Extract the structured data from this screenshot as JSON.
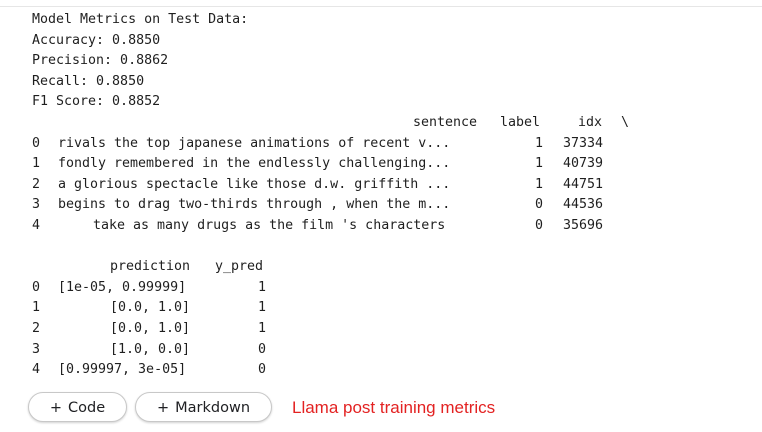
{
  "output": {
    "metrics": {
      "header": "Model Metrics on Test Data:",
      "accuracy": "Accuracy: 0.8850",
      "precision": "Precision: 0.8862",
      "recall": "Recall: 0.8850",
      "f1": "F1 Score: 0.8852"
    },
    "table1": {
      "columns": [
        "sentence",
        "label",
        "idx",
        "\\"
      ],
      "rows": [
        {
          "index": "0",
          "sentence": "rivals the top japanese animations of recent v...",
          "label": "1",
          "idx": "37334"
        },
        {
          "index": "1",
          "sentence": "fondly remembered in the endlessly challenging...",
          "label": "1",
          "idx": "40739"
        },
        {
          "index": "2",
          "sentence": "a glorious spectacle like those d.w. griffith ...",
          "label": "1",
          "idx": "44751"
        },
        {
          "index": "3",
          "sentence": "begins to drag two-thirds through , when the m...",
          "label": "0",
          "idx": "44536"
        },
        {
          "index": "4",
          "sentence": "take as many drugs as the film 's characters",
          "label": "0",
          "idx": "35696"
        }
      ]
    },
    "table2": {
      "columns": [
        "prediction",
        "y_pred"
      ],
      "rows": [
        {
          "index": "0",
          "prediction": "[1e-05, 0.99999]",
          "y_pred": "1"
        },
        {
          "index": "1",
          "prediction": "[0.0, 1.0]",
          "y_pred": "1"
        },
        {
          "index": "2",
          "prediction": "[0.0, 1.0]",
          "y_pred": "1"
        },
        {
          "index": "3",
          "prediction": "[1.0, 0.0]",
          "y_pred": "0"
        },
        {
          "index": "4",
          "prediction": "[0.99997, 3e-05]",
          "y_pred": "0"
        }
      ]
    }
  },
  "toolbar": {
    "code_label": "Code",
    "markdown_label": "Markdown",
    "plus_glyph": "+"
  },
  "annotation": {
    "text": "Llama post training metrics",
    "color": "#e32222"
  }
}
